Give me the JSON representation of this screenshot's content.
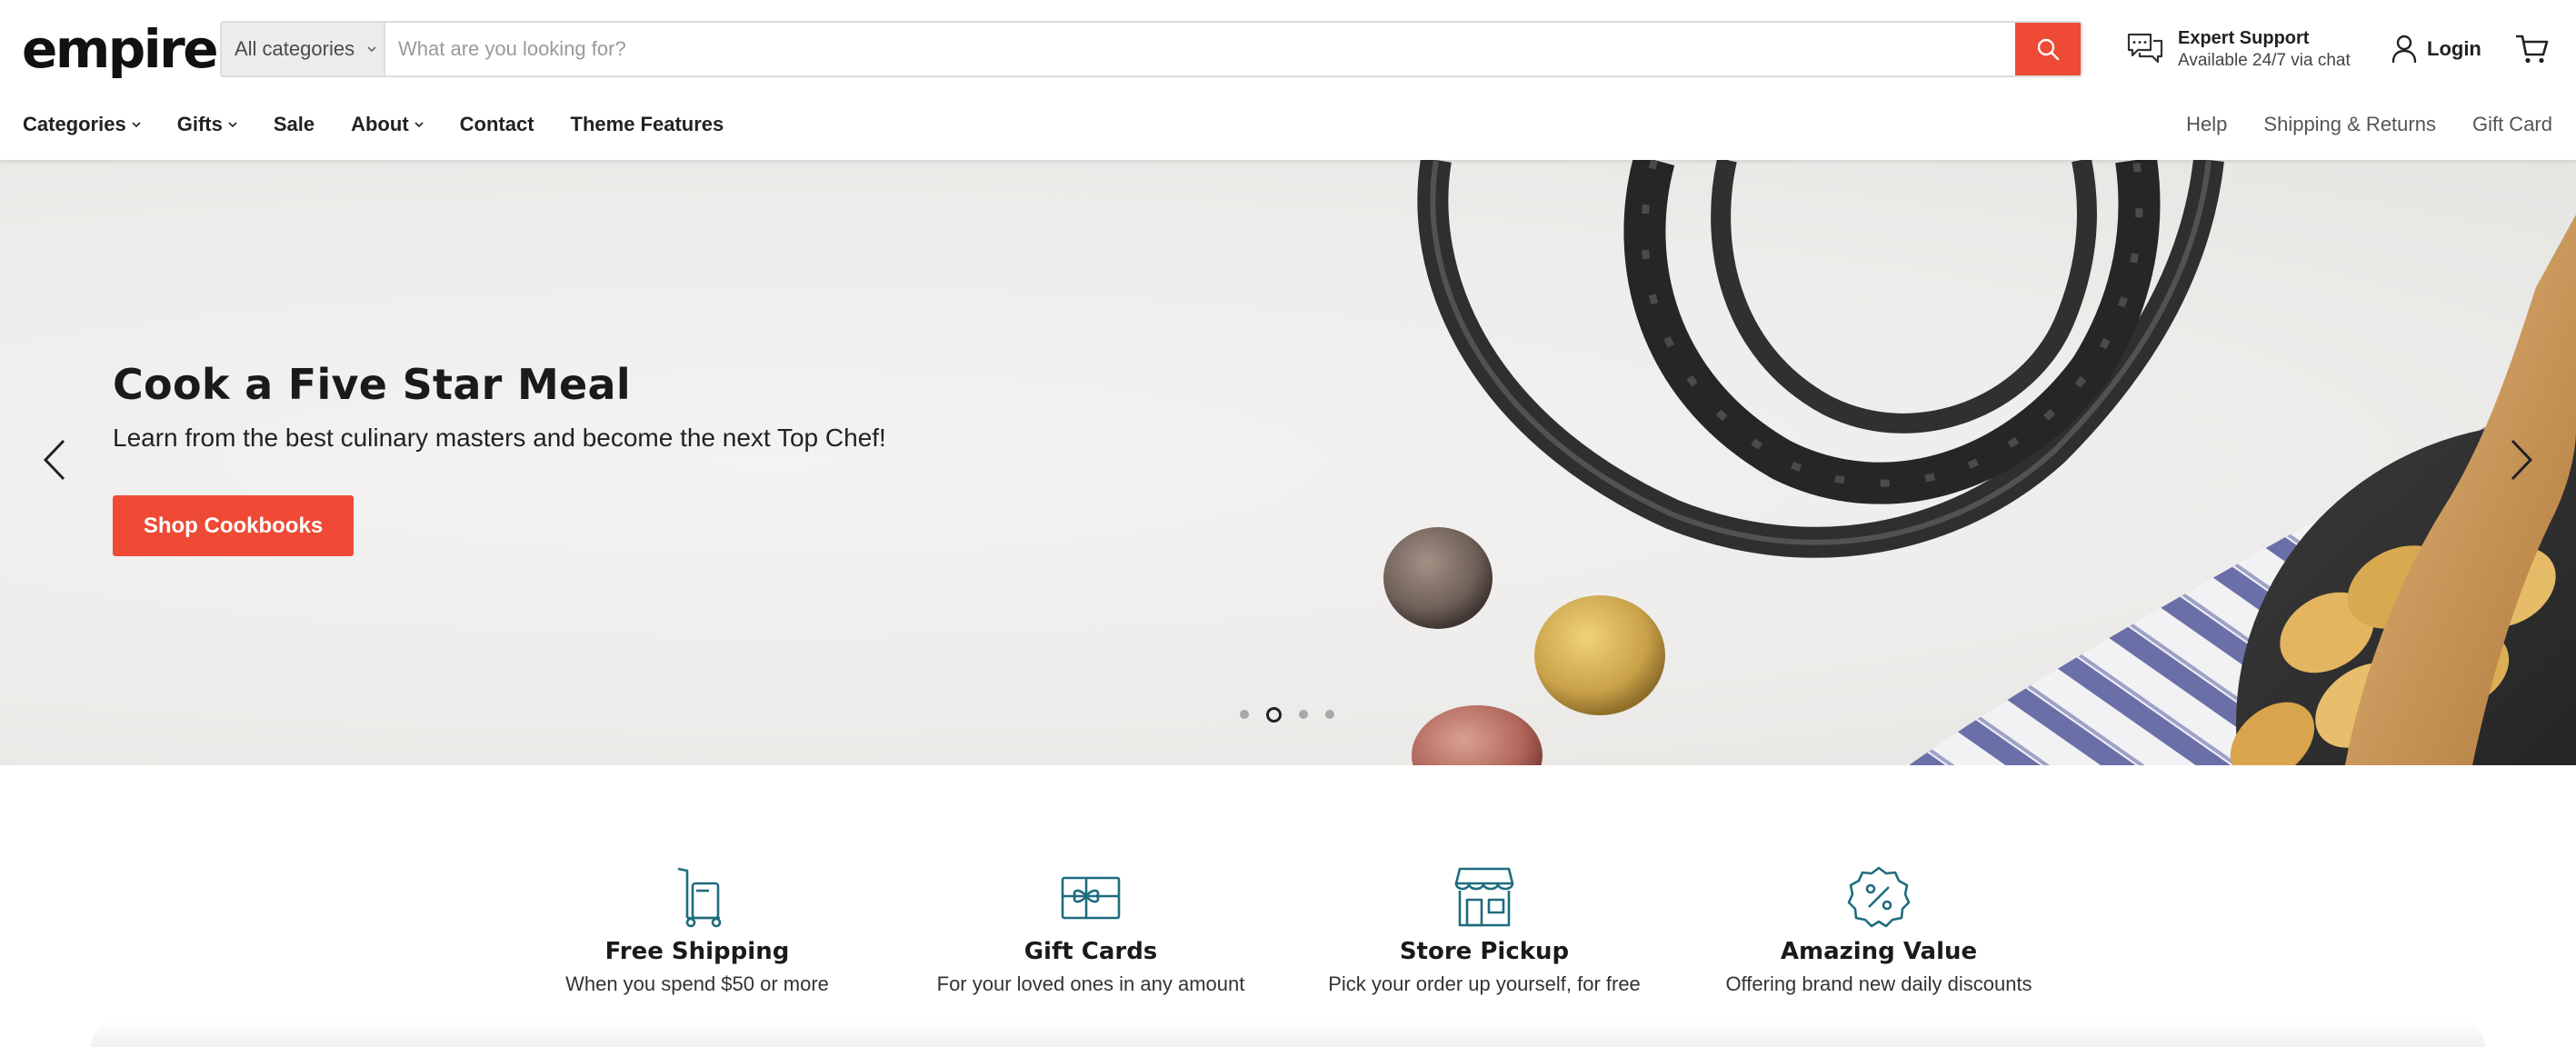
{
  "brand": {
    "logo": "empire",
    "accent": "#ee4a35",
    "icon_color": "#1e6c7f"
  },
  "search": {
    "category": "All categories",
    "placeholder": "What are you looking for?",
    "button_icon": "search-icon"
  },
  "support": {
    "icon": "chat-bubbles-icon",
    "title": "Expert Support",
    "subtitle": "Available 24/7 via chat"
  },
  "account": {
    "login_label": "Login",
    "login_icon": "user-icon",
    "cart_icon": "cart-icon"
  },
  "nav": {
    "left": [
      {
        "label": "Categories",
        "dropdown": true
      },
      {
        "label": "Gifts",
        "dropdown": true
      },
      {
        "label": "Sale",
        "dropdown": false
      },
      {
        "label": "About",
        "dropdown": true
      },
      {
        "label": "Contact",
        "dropdown": false
      },
      {
        "label": "Theme Features",
        "dropdown": false
      }
    ],
    "right": [
      "Help",
      "Shipping & Returns",
      "Gift Card"
    ]
  },
  "hero": {
    "title": "Cook a Five Star Meal",
    "subtitle": "Learn from the best culinary masters and become the next Top Chef!",
    "cta": "Shop Cookbooks",
    "slide_count": 4,
    "active_slide": 2,
    "prev_icon": "chevron-left-icon",
    "next_icon": "chevron-right-icon"
  },
  "features": [
    {
      "icon": "hand-truck-icon",
      "title": "Free Shipping",
      "text": "When you spend $50 or more"
    },
    {
      "icon": "gift-card-icon",
      "title": "Gift Cards",
      "text": "For your loved ones in any amount"
    },
    {
      "icon": "storefront-icon",
      "title": "Store Pickup",
      "text": "Pick your order up yourself, for free"
    },
    {
      "icon": "percent-badge-icon",
      "title": "Amazing Value",
      "text": "Offering brand new daily discounts"
    }
  ]
}
